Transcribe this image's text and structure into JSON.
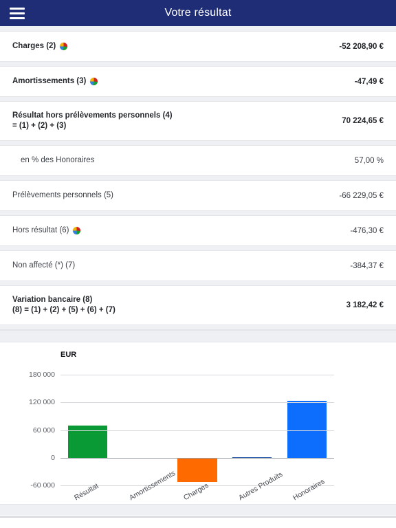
{
  "header": {
    "title": "Votre résultat",
    "menu_icon": "hamburger-menu-icon",
    "background": "#1f2d77"
  },
  "table": {
    "rows": [
      {
        "label": "Charges (2)",
        "label2": "",
        "value": "-52 208,90 €",
        "bold": true,
        "indent": false,
        "pie": true
      },
      {
        "label": "Amortissements (3)",
        "label2": "",
        "value": "-47,49 €",
        "bold": true,
        "indent": false,
        "pie": true
      },
      {
        "label": "Résultat hors prélèvements personnels (4)",
        "label2": "= (1) + (2) + (3)",
        "value": "70 224,65 €",
        "bold": true,
        "indent": false,
        "pie": false
      },
      {
        "label": "en % des Honoraires",
        "label2": "",
        "value": "57,00 %",
        "bold": false,
        "indent": true,
        "pie": false
      },
      {
        "label": "Prélèvements personnels (5)",
        "label2": "",
        "value": "-66 229,05 €",
        "bold": false,
        "indent": false,
        "pie": false
      },
      {
        "label": "Hors résultat (6)",
        "label2": "",
        "value": "-476,30 €",
        "bold": false,
        "indent": false,
        "pie": true
      },
      {
        "label": "Non affecté (*) (7)",
        "label2": "",
        "value": "-384,37 €",
        "bold": false,
        "indent": false,
        "pie": false
      },
      {
        "label": "Variation bancaire (8)",
        "label2": "(8) = (1) + (2) + (5) + (6) + (7)",
        "value": "3 182,42 €",
        "bold": true,
        "indent": false,
        "pie": false
      }
    ]
  },
  "chart_data": {
    "type": "bar",
    "title": "",
    "axis_unit_label": "EUR",
    "categories": [
      "Résultat",
      "Amortissements",
      "Charges",
      "Autres Produits",
      "Honoraires"
    ],
    "values": [
      70224.65,
      -47.49,
      -52208.9,
      476.3,
      123200
    ],
    "colors": [
      "#0a9a35",
      "#c8902a",
      "#ff6a00",
      "#2a5aa8",
      "#0d6efd"
    ],
    "xlabel": "",
    "ylabel": "EUR",
    "ylim": [
      -60000,
      180000
    ],
    "yticks": [
      180000,
      120000,
      60000,
      0,
      -60000
    ],
    "ytick_labels": [
      "180 000",
      "120 000",
      "60 000",
      "0",
      "-60 000"
    ],
    "grid": true,
    "legend": "none",
    "label_rotation": -30
  }
}
